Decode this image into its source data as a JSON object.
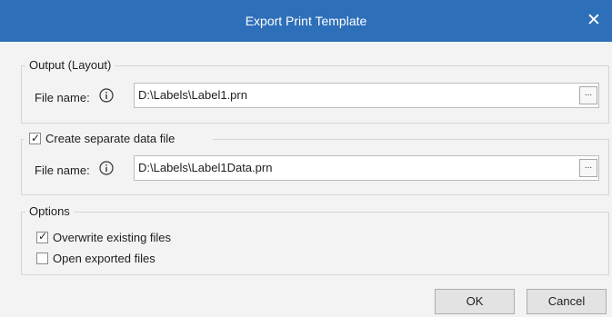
{
  "window": {
    "title": "Export Print Template"
  },
  "output_group": {
    "legend": "Output (Layout)",
    "file_label": "File name:",
    "file_value": "D:\\Labels\\Label1.prn",
    "browse_label": "..."
  },
  "data_group": {
    "checkbox_label": "Create separate data file",
    "checked": true,
    "file_label": "File name:",
    "file_value": "D:\\Labels\\Label1Data.prn",
    "browse_label": "..."
  },
  "options_group": {
    "legend": "Options",
    "overwrite_label": "Overwrite existing files",
    "overwrite_checked": true,
    "open_label": "Open exported files",
    "open_checked": false
  },
  "buttons": {
    "ok": "OK",
    "cancel": "Cancel"
  },
  "icons": {
    "close": "close-icon",
    "info": "info-icon",
    "check": "check-icon"
  },
  "colors": {
    "titlebar": "#2d6fb9"
  }
}
